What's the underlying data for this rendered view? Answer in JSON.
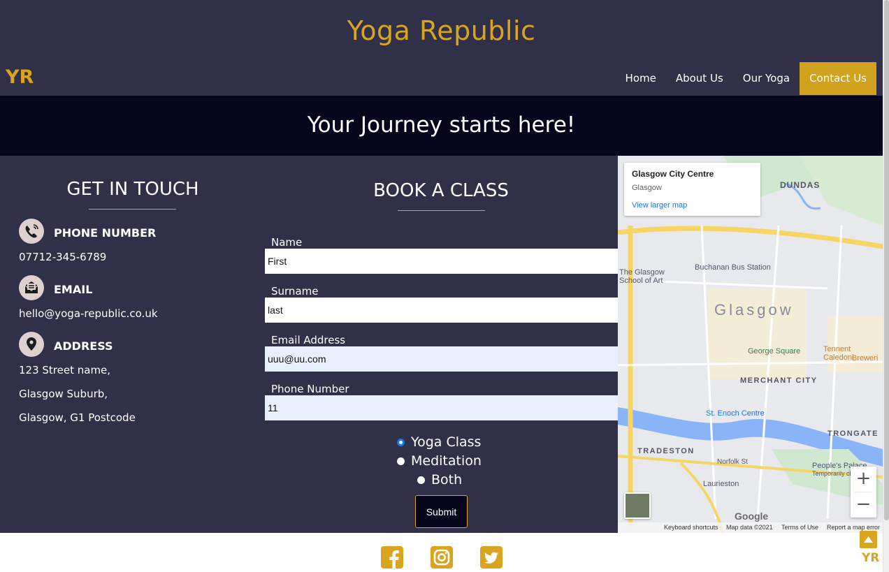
{
  "colors": {
    "accent": "#d9a521",
    "header_bg": "#303048",
    "banner_bg": "#05051c",
    "input_autofill": "#e8f0fe"
  },
  "header": {
    "site_title": "Yoga Republic",
    "logo": "YR",
    "nav": [
      {
        "label": "Home",
        "active": false
      },
      {
        "label": "About Us",
        "active": false
      },
      {
        "label": "Our Yoga",
        "active": false
      },
      {
        "label": "Contact Us",
        "active": true
      }
    ]
  },
  "banner": {
    "text": "Your Journey starts here!"
  },
  "contact": {
    "title": "GET IN TOUCH",
    "phone": {
      "icon": "phone-icon",
      "heading": "PHONE NUMBER",
      "value": "07712-345-6789"
    },
    "email": {
      "icon": "envelope-icon",
      "heading": "EMAIL",
      "value": "hello@yoga-republic.co.uk"
    },
    "address": {
      "icon": "location-pin-icon",
      "heading": "ADDRESS",
      "lines": [
        "123 Street name,",
        "Glasgow Suburb,",
        "Glasgow, G1 Postcode"
      ]
    }
  },
  "booking": {
    "title": "BOOK A CLASS",
    "fields": [
      {
        "label": "Name",
        "value": "First"
      },
      {
        "label": "Surname",
        "value": "last"
      },
      {
        "label": "Email Address",
        "value": "uuu@uu.com"
      },
      {
        "label": "Phone Number",
        "value": "11"
      }
    ],
    "options": [
      {
        "label": "Yoga Class",
        "checked": true
      },
      {
        "label": "Meditation",
        "checked": false
      },
      {
        "label": "Both",
        "checked": false
      }
    ],
    "submit_label": "Submit"
  },
  "map": {
    "place_name": "Glasgow City Centre",
    "place_sub": "Glasgow",
    "larger_map": "View larger map",
    "labels": {
      "dundas": "DUNDAS",
      "glasgow": "Glasgow",
      "bus_station": "Buchanan Bus Station",
      "school_of_art_1": "The Glasgow",
      "school_of_art_2": "School of Art",
      "george_square": "George Square",
      "tennent_1": "Tennent Caledoni",
      "tennent_2": "Breweri",
      "merchant_city": "MERCHANT CITY",
      "st_enoch": "St. Enoch Centre",
      "trongate": "TRONGATE",
      "tradeston": "TRADESTON",
      "norfolk_st": "Norfolk St",
      "laurieston": "Laurieston",
      "peoples_palace_1": "People's Palace",
      "peoples_palace_2": "Temporarily cl"
    },
    "zoom_in": "+",
    "zoom_out": "−",
    "google": "Google",
    "footer": {
      "shortcuts": "Keyboard shortcuts",
      "data": "Map data ©2021",
      "terms": "Terms of Use",
      "report": "Report a map error"
    }
  },
  "footer": {
    "social": [
      {
        "icon": "facebook-icon"
      },
      {
        "icon": "instagram-icon"
      },
      {
        "icon": "twitter-icon"
      }
    ],
    "back_logo": "YR"
  }
}
